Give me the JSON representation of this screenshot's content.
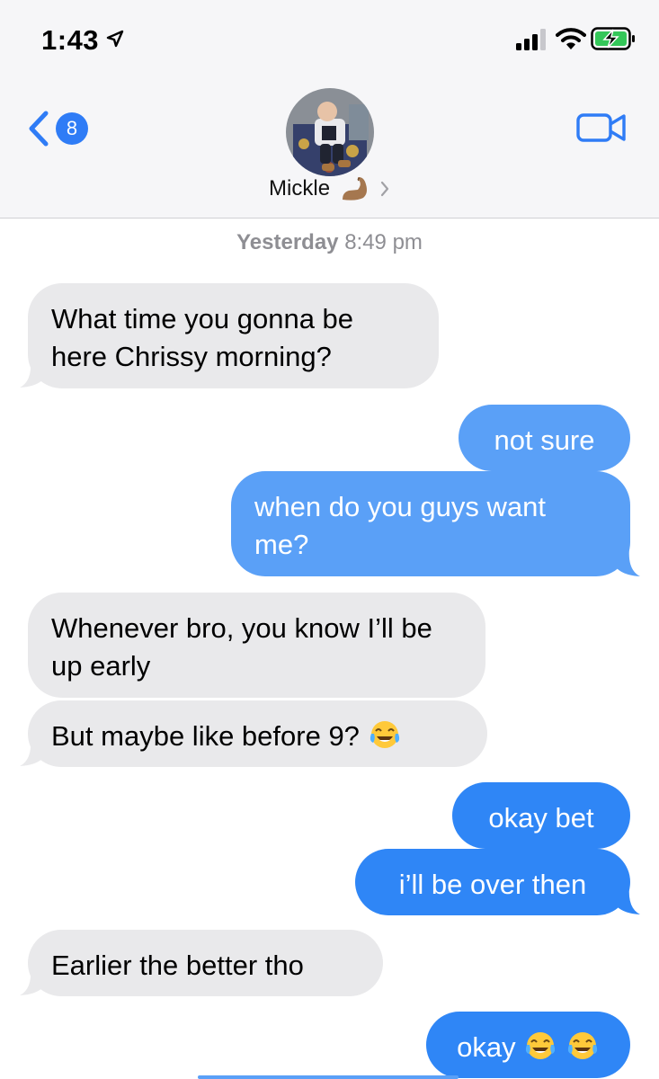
{
  "status_bar": {
    "time": "1:43",
    "icons": [
      "location-arrow-icon",
      "cellular-signal-icon",
      "wifi-icon",
      "battery-charging-icon"
    ],
    "accent_color": "#2f7cf6",
    "battery_color": "#34c759"
  },
  "header": {
    "back_badge_count": "8",
    "contact_name": "Mickle",
    "contact_emoji": "flexed-biceps-emoji",
    "video_icon": "video-camera-icon"
  },
  "thread": {
    "timestamp_day": "Yesterday",
    "timestamp_time": "8:49 pm",
    "messages": [
      {
        "side": "incoming",
        "text": "What time you gonna be here Chrissy morning?"
      },
      {
        "side": "outgoing",
        "text": "not sure"
      },
      {
        "side": "outgoing",
        "text": "when do you guys want me?"
      },
      {
        "side": "incoming",
        "text": "Whenever bro, you know I’ll be up early"
      },
      {
        "side": "incoming",
        "text": "But maybe like before 9?",
        "emoji": "face-with-tears-of-joy"
      },
      {
        "side": "outgoing",
        "text": "okay bet"
      },
      {
        "side": "outgoing",
        "text": "i’ll be over then"
      },
      {
        "side": "incoming",
        "text": "Earlier the better tho"
      },
      {
        "side": "outgoing",
        "text": "okay",
        "emoji": "face-with-tears-of-joy x2"
      }
    ]
  },
  "colors": {
    "incoming_bubble": "#e9e9eb",
    "outgoing_bubble": "#2f86f6",
    "outgoing_bubble_light": "#5aa0f7",
    "timestamp_text": "#8e8e93"
  }
}
